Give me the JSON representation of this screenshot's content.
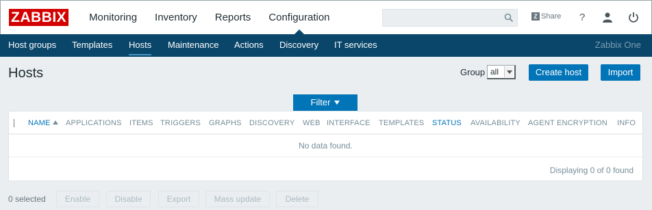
{
  "header": {
    "logo_text": "ZABBIX",
    "main_nav": [
      "Monitoring",
      "Inventory",
      "Reports",
      "Configuration"
    ],
    "active_main": "Configuration",
    "search_placeholder": "",
    "share_badge": "Z",
    "share_label": "Share",
    "help_label": "?"
  },
  "subnav": {
    "items": [
      "Host groups",
      "Templates",
      "Hosts",
      "Maintenance",
      "Actions",
      "Discovery",
      "IT services"
    ],
    "active": "Hosts",
    "server_name": "Zabbix One"
  },
  "page": {
    "title": "Hosts",
    "group_label": "Group",
    "group_value": "all",
    "create_button": "Create host",
    "import_button": "Import",
    "filter_label": "Filter"
  },
  "table": {
    "columns": [
      "NAME",
      "APPLICATIONS",
      "ITEMS",
      "TRIGGERS",
      "GRAPHS",
      "DISCOVERY",
      "WEB",
      "INTERFACE",
      "TEMPLATES",
      "STATUS",
      "AVAILABILITY",
      "AGENT ENCRYPTION",
      "INFO"
    ],
    "sortable_columns": [
      "NAME",
      "STATUS"
    ],
    "sorted_column": "NAME",
    "sort_direction": "ascending",
    "empty_message": "No data found.",
    "paging_text": "Displaying 0 of 0 found"
  },
  "footer": {
    "selected_text": "0 selected",
    "actions": [
      "Enable",
      "Disable",
      "Export",
      "Mass update",
      "Delete"
    ]
  },
  "colors": {
    "brand_red": "#d40000",
    "subnav_bg": "#0a466a",
    "primary_button": "#0275b8",
    "page_bg": "#ebeef0"
  }
}
